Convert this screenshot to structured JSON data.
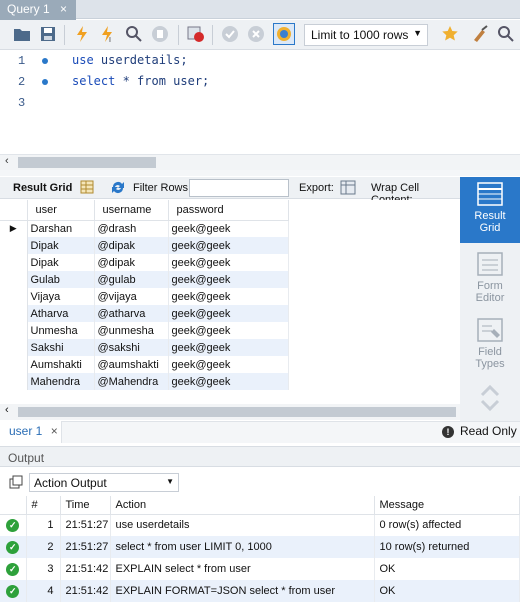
{
  "tab": {
    "title": "Query 1",
    "close": "×"
  },
  "toolbar": {
    "limit_value": "Limit to 1000 rows"
  },
  "editor": {
    "lines": [
      {
        "num": "1",
        "code_kw": "use",
        "code_rest": " userdetails;"
      },
      {
        "num": "2",
        "code_kw": "select",
        "code_rest": " * from user;"
      },
      {
        "num": "3",
        "code_kw": "",
        "code_rest": ""
      }
    ]
  },
  "gridtoolbar": {
    "result_grid": "Result Grid",
    "filter_rows": "Filter Rows:",
    "filter_value": "",
    "export": "Export:",
    "wrap": "Wrap Cell Content:"
  },
  "grid": {
    "columns": [
      "user",
      "username",
      "password"
    ],
    "rows": [
      [
        "Darshan",
        "@drash",
        "geek@geek"
      ],
      [
        "Dipak",
        "@dipak",
        "geek@geek"
      ],
      [
        "Dipak",
        "@dipak",
        "geek@geek"
      ],
      [
        "Gulab",
        "@gulab",
        "geek@geek"
      ],
      [
        "Vijaya",
        "@vijaya",
        "geek@geek"
      ],
      [
        "Atharva",
        "@atharva",
        "geek@geek"
      ],
      [
        "Unmesha",
        "@unmesha",
        "geek@geek"
      ],
      [
        "Sakshi",
        "@sakshi",
        "geek@geek"
      ],
      [
        "Aumshakti",
        "@aumshakti",
        "geek@geek"
      ],
      [
        "Mahendra",
        "@Mahendra",
        "geek@geek"
      ]
    ]
  },
  "sidepanel": {
    "result_grid_l1": "Result",
    "result_grid_l2": "Grid",
    "form_editor_l1": "Form",
    "form_editor_l2": "Editor",
    "field_types_l1": "Field",
    "field_types_l2": "Types"
  },
  "resulttabs": {
    "user_tab": "user 1",
    "close": "×",
    "status": "Read Only"
  },
  "output": {
    "header": "Output",
    "selector": "Action Output",
    "columns": [
      "#",
      "Time",
      "Action",
      "Message"
    ],
    "rows": [
      {
        "n": "1",
        "time": "21:51:27",
        "action": "use userdetails",
        "message": "0 row(s) affected"
      },
      {
        "n": "2",
        "time": "21:51:27",
        "action": "select * from user LIMIT 0, 1000",
        "message": "10 row(s) returned"
      },
      {
        "n": "3",
        "time": "21:51:42",
        "action": "EXPLAIN select * from user",
        "message": "OK"
      },
      {
        "n": "4",
        "time": "21:51:42",
        "action": "EXPLAIN FORMAT=JSON select * from user",
        "message": "OK"
      }
    ]
  },
  "colors": {
    "accent": "#2a78c9",
    "ok": "#2ea13b",
    "row_alt": "#eaf1fb"
  }
}
